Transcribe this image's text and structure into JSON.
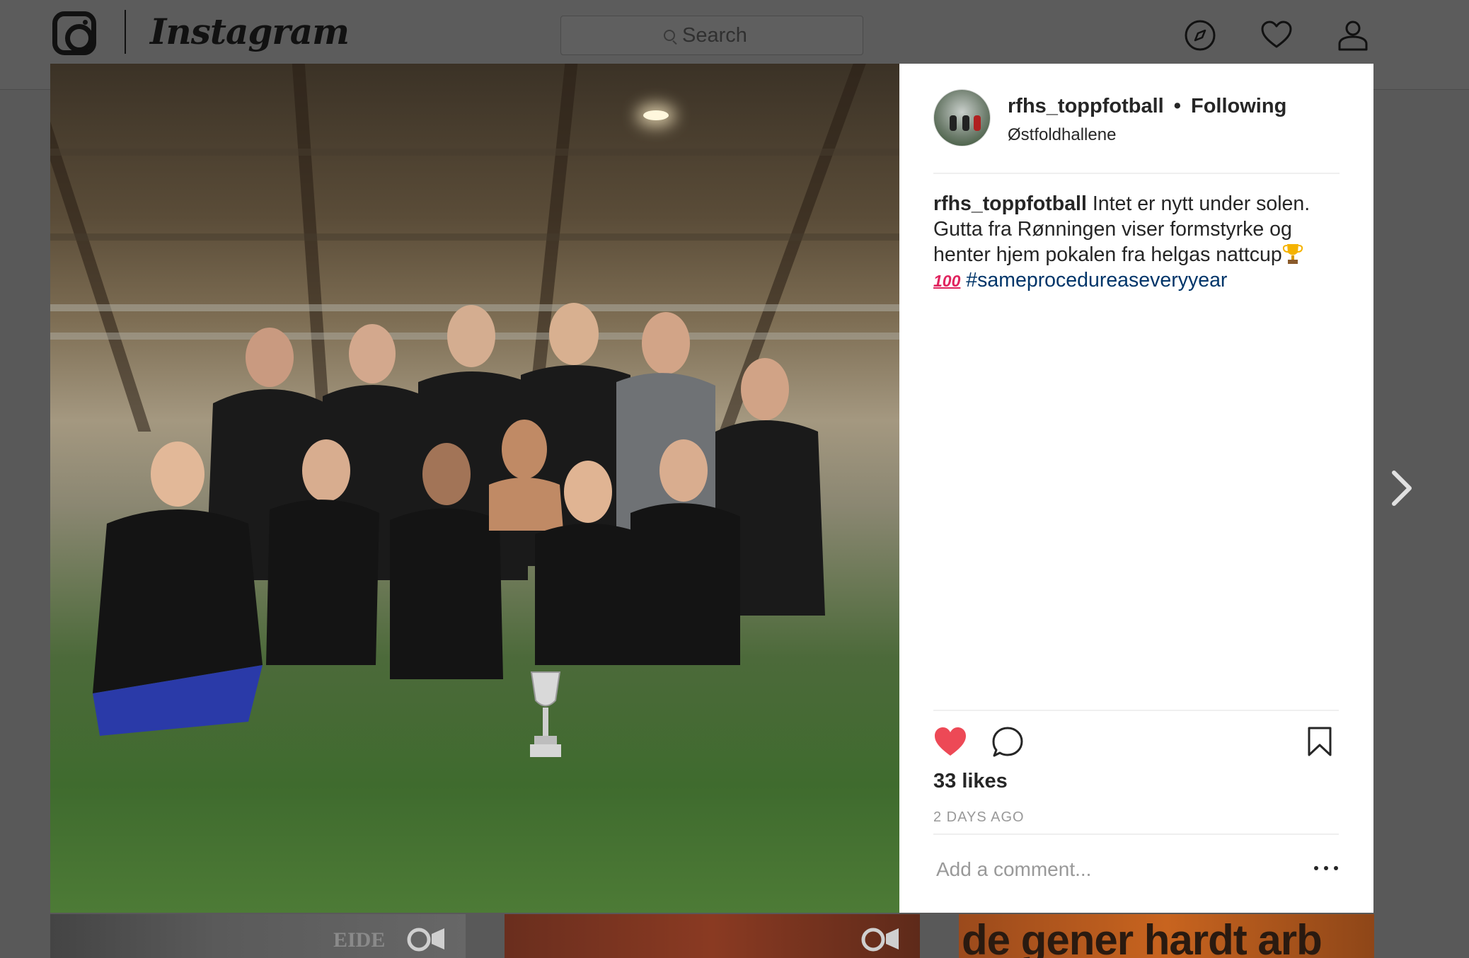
{
  "header": {
    "logo_text": "Instagram",
    "search_placeholder": "Search"
  },
  "post": {
    "username": "rfhs_toppfotball",
    "separator": "•",
    "follow_status": "Following",
    "location": "Østfoldhallene",
    "caption": {
      "username": "rfhs_toppfotball",
      "text": "Intet er nytt under solen. Gutta fra Rønningen viser formstyrke og henter hjem pokalen fra helgas nattcup",
      "emoji_100": "100",
      "hashtag": "#sameprocedureaseveryyear"
    },
    "likes": "33 likes",
    "timestamp": "2 DAYS AGO",
    "liked": true,
    "comment_placeholder": "Add a comment..."
  },
  "grid_thumbnails": [
    {
      "text": "EIDE",
      "type": "video"
    },
    {
      "text": "",
      "type": "video"
    },
    {
      "text": "de gener hardt arb",
      "type": "image"
    }
  ],
  "colors": {
    "like_red": "#ed4956",
    "hashtag_blue": "#003569",
    "muted_gray": "#999999",
    "overlay_dim": "#595959"
  },
  "icons": {
    "header": [
      "instagram-logo-icon",
      "explore-compass-icon",
      "activity-heart-icon",
      "profile-user-icon"
    ],
    "actions": [
      "like-heart-icon",
      "comment-bubble-icon",
      "save-bookmark-icon",
      "more-options-icon"
    ],
    "navigation": [
      "next-chevron-icon"
    ]
  }
}
